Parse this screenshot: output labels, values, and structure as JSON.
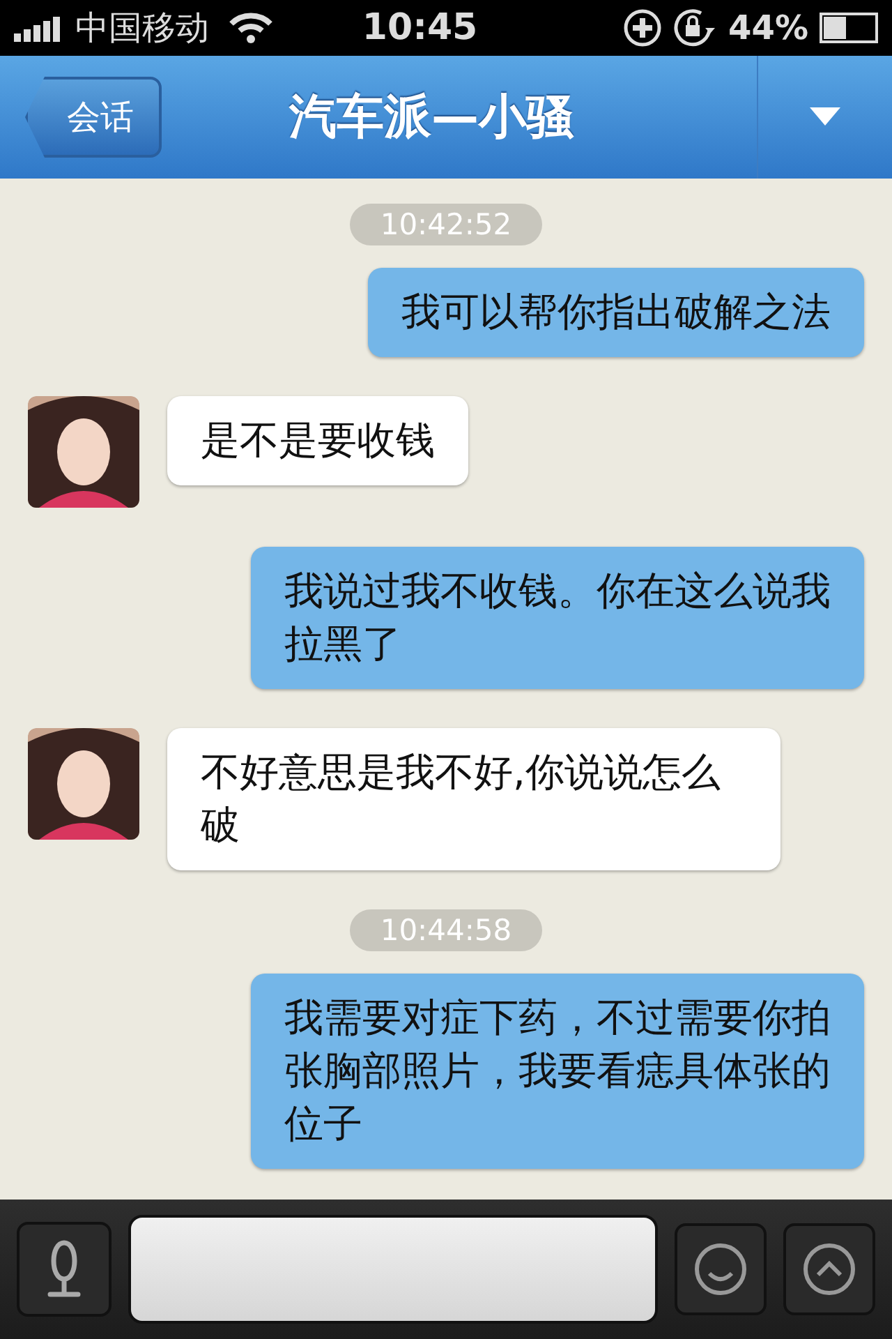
{
  "status_bar": {
    "carrier": "中国移动",
    "time": "10:45",
    "battery": "44%"
  },
  "nav": {
    "back": "会话",
    "title": "汽车派—小骚"
  },
  "messages": [
    {
      "kind": "time",
      "text": "10:42:52"
    },
    {
      "kind": "outgoing",
      "text": "我可以帮你指出破解之法"
    },
    {
      "kind": "incoming",
      "text": "是不是要收钱"
    },
    {
      "kind": "outgoing",
      "text": "我说过我不收钱。你在这么说我拉黑了"
    },
    {
      "kind": "incoming",
      "text": "不好意思是我不好,你说说怎么破"
    },
    {
      "kind": "time",
      "text": "10:44:58"
    },
    {
      "kind": "outgoing",
      "text": "我需要对症下药，不过需要你拍张胸部照片，我要看痣具体张的位子"
    }
  ]
}
